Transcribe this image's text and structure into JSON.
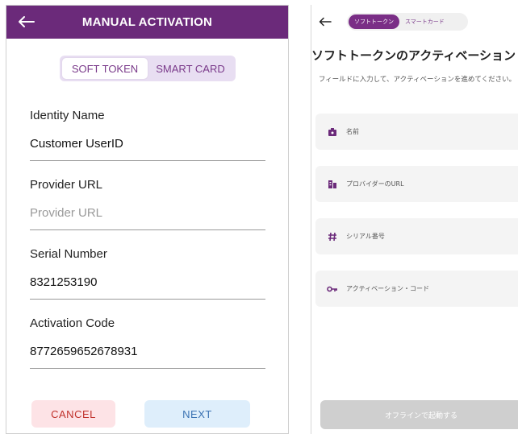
{
  "left": {
    "title": "MANUAL ACTIVATION",
    "tabs": [
      {
        "label": "SOFT TOKEN",
        "active": true
      },
      {
        "label": "SMART CARD",
        "active": false
      }
    ],
    "fields": [
      {
        "label": "Identity Name",
        "value": "Customer UserID",
        "placeholder": false
      },
      {
        "label": "Provider URL",
        "value": "Provider URL",
        "placeholder": true
      },
      {
        "label": "Serial Number",
        "value": "8321253190",
        "placeholder": false
      },
      {
        "label": "Activation Code",
        "value": "8772659652678931",
        "placeholder": false
      }
    ],
    "cancel_label": "CANCEL",
    "next_label": "NEXT",
    "colors": {
      "header": "#6b2a7a",
      "cancel_text": "#c0312b",
      "next_text": "#3b73b3"
    }
  },
  "right": {
    "tabs": [
      {
        "label": "ソフトトークン",
        "active": true
      },
      {
        "label": "スマートカード",
        "active": false
      }
    ],
    "title": "ソフトトークンのアクティベーション",
    "description": "フィールドに入力して、アクティベーションを進めてください。",
    "fields": [
      {
        "icon": "id-badge-icon",
        "label": "名前"
      },
      {
        "icon": "building-icon",
        "label": "プロバイダーのURL"
      },
      {
        "icon": "hash-icon",
        "label": "シリアル番号"
      },
      {
        "icon": "key-icon",
        "label": "アクティベーション・コード"
      }
    ],
    "button_label": "オフラインで起動する",
    "colors": {
      "accent": "#7a2e86"
    }
  }
}
